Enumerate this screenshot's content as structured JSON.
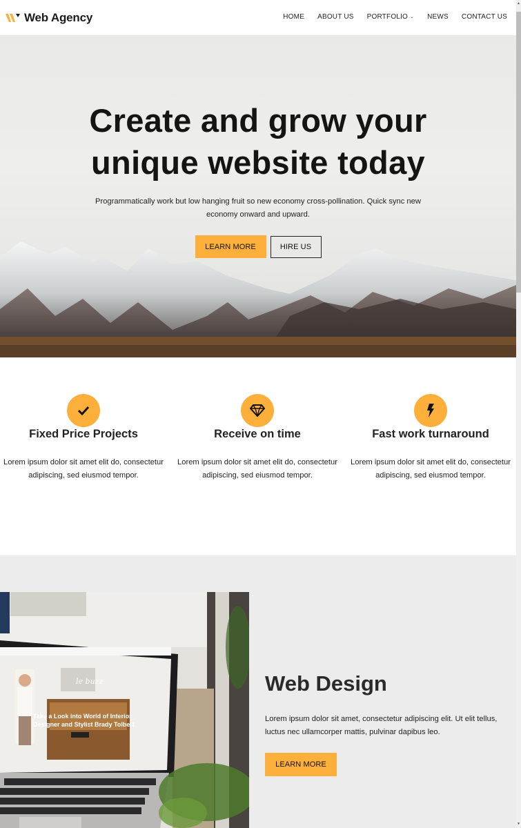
{
  "header": {
    "brand": "Web Agency",
    "nav": [
      {
        "label": "HOME"
      },
      {
        "label": "ABOUT US"
      },
      {
        "label": "PORTFOLIO",
        "has_dropdown": true
      },
      {
        "label": "NEWS"
      },
      {
        "label": "CONTACT US"
      }
    ]
  },
  "hero": {
    "title_line1": "Create and grow your",
    "title_line2": "unique website today",
    "subtitle": "Programmatically work but low hanging fruit so new economy cross-pollination. Quick sync new economy onward and upward.",
    "primary_button": "LEARN MORE",
    "secondary_button": "HIRE US",
    "background": "snowy-mountains-photo"
  },
  "features": [
    {
      "icon": "checkmark-icon",
      "title": "Fixed Price Projects",
      "text": "Lorem ipsum dolor sit amet elit do, consectetur adipiscing, sed eiusmod tempor."
    },
    {
      "icon": "diamond-icon",
      "title": "Receive on time",
      "text": "Lorem ipsum dolor sit amet elit do, consectetur adipiscing, sed eiusmod tempor."
    },
    {
      "icon": "lightning-bolt-icon",
      "title": "Fast work turnaround",
      "text": "Lorem ipsum dolor sit amet elit do, consectetur adipiscing, sed eiusmod tempor."
    }
  ],
  "web_design": {
    "title": "Web Design",
    "text": "Lorem ipsum dolor sit amet, consectetur adipiscing elit. Ut elit tellus, luctus nec ullamcorper mattis, pulvinar dapibus leo.",
    "button": "LEARN MORE",
    "image": "laptop-on-desk-photo",
    "image_screen_text": "Take a Look into World of Interior Designer and Stylist Brady Tolbert",
    "image_screen_logo": "le buzz"
  },
  "colors": {
    "accent": "#fdaf3b",
    "text_dark": "#222222",
    "section_gray": "#ececec",
    "white": "#ffffff"
  }
}
